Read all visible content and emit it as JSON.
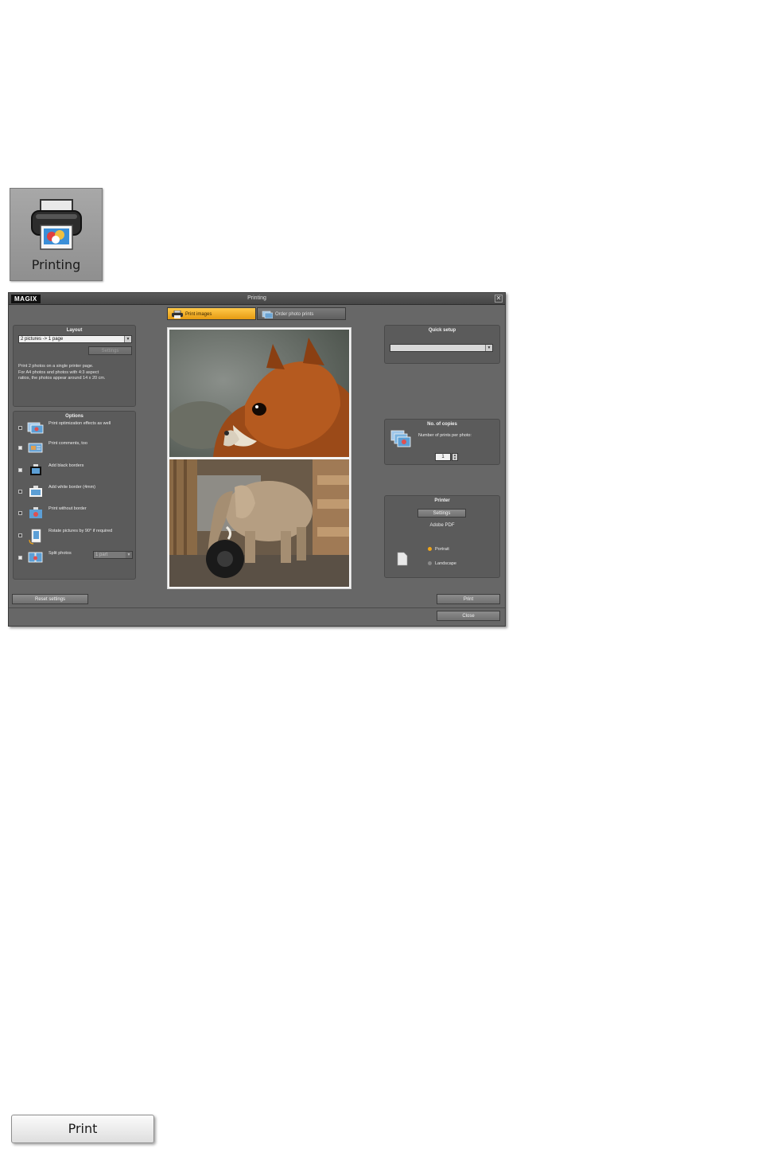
{
  "tile": {
    "label": "Printing",
    "icon": "printer-icon"
  },
  "window": {
    "logo": "MAGIX",
    "title": "Printing",
    "close_symbol": "✕",
    "tabs": [
      {
        "label": "Print images",
        "icon": "printer-icon",
        "active": true
      },
      {
        "label": "Order photo prints",
        "icon": "photo-order-icon",
        "active": false
      }
    ],
    "layout": {
      "title": "Layout",
      "selected": "2 pictures -> 1 page",
      "settings_button": "Settings",
      "description_lines": [
        "Print 2 photos on a single printer page.",
        "For A4 photos and photos with 4:3 aspect",
        "ratios, the photos appear around 14 x 20 cm."
      ]
    },
    "options": {
      "title": "Options",
      "items": [
        {
          "label": "Print optimization effects as well",
          "checked": false,
          "icon": "effects-icon"
        },
        {
          "label": "Print comments, too",
          "checked": true,
          "icon": "comment-icon"
        },
        {
          "label": "Add black borders",
          "checked": true,
          "icon": "black-border-icon"
        },
        {
          "label": "Add white border (4mm)",
          "checked": false,
          "icon": "white-border-icon"
        },
        {
          "label": "Print without border",
          "checked": false,
          "icon": "no-border-icon"
        },
        {
          "label": "Rotate pictures by 90° if required",
          "checked": false,
          "icon": "rotate-icon"
        },
        {
          "label": "Split photos",
          "checked": true,
          "icon": "split-icon",
          "select": "1 part"
        }
      ]
    },
    "quick_setup": {
      "title": "Quick setup",
      "selected": ""
    },
    "copies": {
      "title": "No. of copies",
      "label": "Number of prints per photo:",
      "value": "1"
    },
    "printer": {
      "title": "Printer",
      "settings_button": "Settings",
      "name": "Adobe PDF",
      "portrait": "Portrait",
      "landscape": "Landscape",
      "orientation": "Portrait"
    },
    "reset_button": "Reset settings",
    "print_button": "Print",
    "close_button": "Close"
  },
  "standalone_button": {
    "label": "Print"
  },
  "colors": {
    "accent": "#f0a51a",
    "window_bg": "#676767",
    "panel_bg": "#5b5b5b"
  }
}
